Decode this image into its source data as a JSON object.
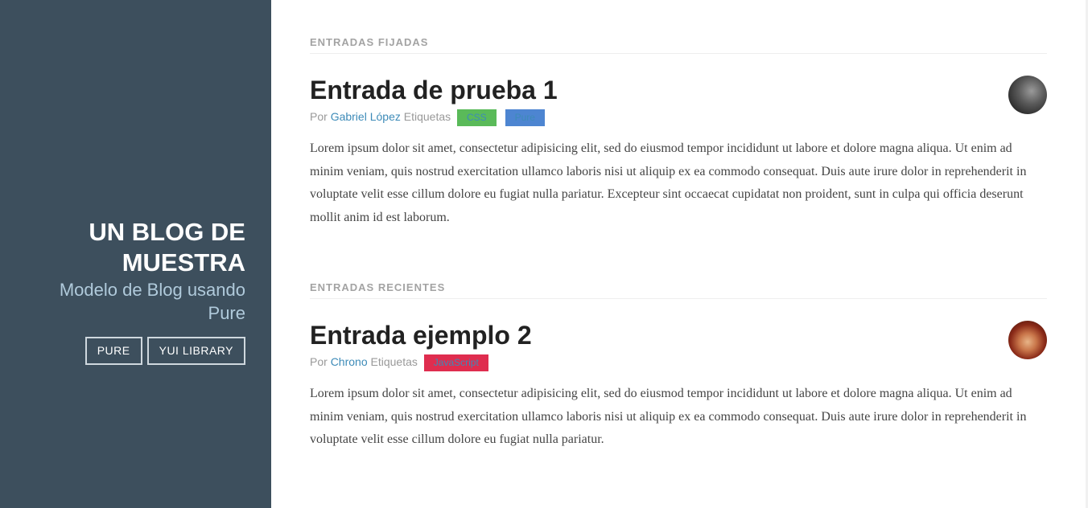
{
  "sidebar": {
    "title": "UN BLOG DE MUESTRA",
    "tagline": "Modelo de Blog usando Pure",
    "nav": [
      {
        "label": "PURE"
      },
      {
        "label": "YUI LIBRARY"
      }
    ]
  },
  "sections": {
    "pinned_title": "ENTRADAS FIJADAS",
    "recent_title": "ENTRADAS RECIENTES"
  },
  "posts": [
    {
      "title": "Entrada de prueba 1",
      "meta_by": "Por",
      "author": "Gabriel López",
      "meta_tags": "Etiquetas",
      "tags": [
        {
          "label": "CSS",
          "color": "#5aba59"
        },
        {
          "label": "Pure",
          "color": "#4d85d1"
        }
      ],
      "avatar_icon": "author-avatar-icon",
      "body": "Lorem ipsum dolor sit amet, consectetur adipisicing elit, sed do eiusmod tempor incididunt ut labore et dolore magna aliqua. Ut enim ad minim veniam, quis nostrud exercitation ullamco laboris nisi ut aliquip ex ea commodo consequat. Duis aute irure dolor in reprehenderit in voluptate velit esse cillum dolore eu fugiat nulla pariatur. Excepteur sint occaecat cupidatat non proident, sunt in culpa qui officia deserunt mollit anim id est laborum."
    },
    {
      "title": "Entrada ejemplo 2",
      "meta_by": "Por",
      "author": "Chrono",
      "meta_tags": "Etiquetas",
      "tags": [
        {
          "label": "JavaScript",
          "color": "#df2d4f"
        }
      ],
      "avatar_icon": "author-avatar-icon",
      "body": "Lorem ipsum dolor sit amet, consectetur adipisicing elit, sed do eiusmod tempor incididunt ut labore et dolore magna aliqua. Ut enim ad minim veniam, quis nostrud exercitation ullamco laboris nisi ut aliquip ex ea commodo consequat. Duis aute irure dolor in reprehenderit in voluptate velit esse cillum dolore eu fugiat nulla pariatur."
    }
  ],
  "colors": {
    "sidebar_bg": "#3d4f5d",
    "tagline": "#b0cadb",
    "link": "#3d8bb8"
  }
}
